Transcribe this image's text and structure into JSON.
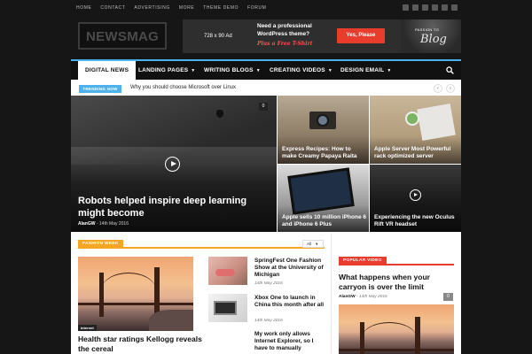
{
  "topbar": {
    "links": [
      "Home",
      "Contact",
      "Advertising",
      "More",
      "Theme Demo",
      "Forum"
    ],
    "social": [
      "facebook-icon",
      "twitter-icon",
      "vimeo-icon",
      "vk-icon",
      "youtube-icon",
      "mail-icon"
    ]
  },
  "header": {
    "logo": "NEWSMAG",
    "ad": {
      "size": "728 x 90 Ad",
      "line1": "Need a professional",
      "line2": "WordPress theme?",
      "tshirt": "Plus a Free T-Shirt",
      "button": "Yes, Please",
      "shirt_text": "PASSION TO",
      "shirt_script": "Blog"
    }
  },
  "nav": {
    "items": [
      {
        "label": "Digital News",
        "active": true,
        "dropdown": false
      },
      {
        "label": "Landing Pages",
        "active": false,
        "dropdown": true
      },
      {
        "label": "Writing Blogs",
        "active": false,
        "dropdown": true
      },
      {
        "label": "Creating Videos",
        "active": false,
        "dropdown": true
      },
      {
        "label": "Design Email",
        "active": false,
        "dropdown": true
      }
    ],
    "search_icon": "search-icon"
  },
  "trending": {
    "badge": "TRENDING NOW",
    "headline": "Why you should choose Microsoft over Linux",
    "prev": "‹",
    "next": "›"
  },
  "featured": {
    "main": {
      "count": "0",
      "title": "Robots helped inspire deep learning might become",
      "author": "AlanGW",
      "date": "14th May 2016"
    },
    "tiles": [
      {
        "caption": "Express Recipes: How to make Creamy Papaya Raita"
      },
      {
        "caption": "Apple Server Most Powerful rack optimized server"
      },
      {
        "caption": "Apple sells 10 million iPhone 6 and iPhone 6 Plus"
      },
      {
        "caption": "Experiencing the new Oculus Rift VR headset"
      }
    ]
  },
  "fashion": {
    "badge": "FASHION WEEK",
    "filter": "All",
    "main": {
      "tag": "Internet",
      "title": "Health star ratings Kellogg reveals the cereal"
    },
    "list": [
      {
        "title": "SpringFest One Fashion Show at the University of Michigan",
        "date": "14th May 2016"
      },
      {
        "title": "Xbox One to launch in China this month after all",
        "date": "14th May 2016"
      },
      {
        "title": "My work only allows Internet Explorer, so I have to manually",
        "date": ""
      }
    ]
  },
  "popular": {
    "badge": "POPULAR VIDEO",
    "title": "What happens when your carryon is over the limit",
    "author": "AlanGW",
    "date": "14th May 2016",
    "count": "0"
  },
  "colors": {
    "accent_blue": "#4db2ec",
    "fashion_orange": "#f5a623",
    "popular_red": "#e83d2d",
    "background": "#161616"
  }
}
